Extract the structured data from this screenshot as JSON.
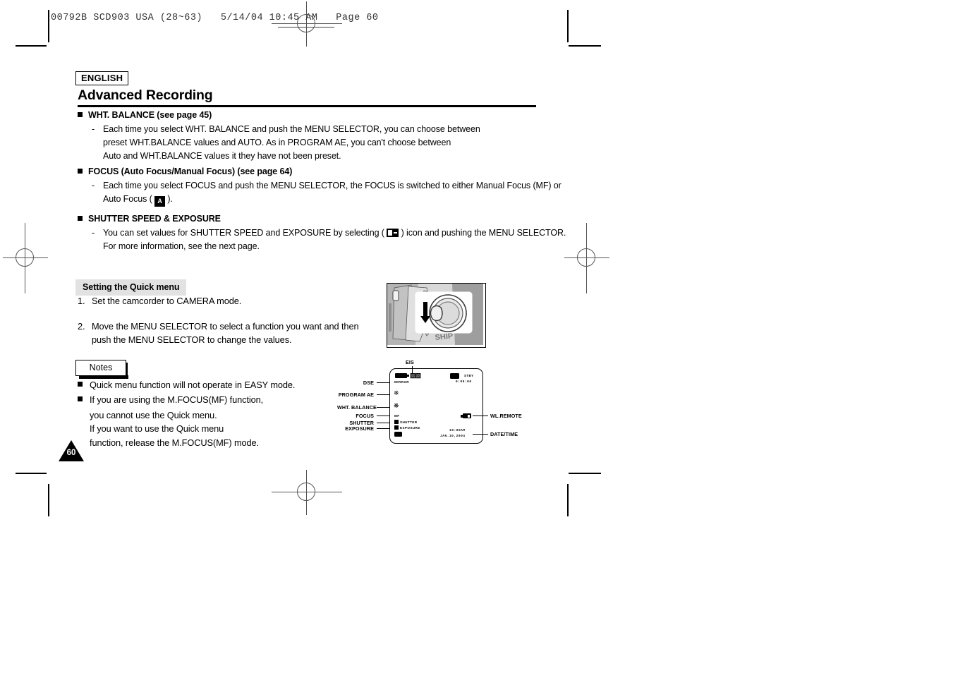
{
  "slug": {
    "text": "00792B SCD903 USA (28~63)   5/14/04 10:45 AM   Page 60"
  },
  "page": {
    "language_badge": "ENGLISH",
    "chapter_title": "Advanced Recording",
    "page_number": "60"
  },
  "sections": [
    {
      "heading": "WHT. BALANCE (see page 45)",
      "lines": [
        "Each time you select WHT. BALANCE and push the MENU SELECTOR, you can choose between",
        "preset WHT.BALANCE values and AUTO. As in PROGRAM AE, you can't choose between",
        "Auto and WHT.BALANCE values it they have not been preset."
      ]
    },
    {
      "heading": "FOCUS (Auto Focus/Manual Focus) (see page 64)",
      "lines": [
        "Each time you select FOCUS and push the MENU SELECTOR, the FOCUS is switched to either Manual Focus (MF) or",
        "Auto Focus (  )."
      ],
      "inline_icon": "auto-focus-a-icon"
    },
    {
      "heading": "SHUTTER SPEED & EXPOSURE",
      "lines": [
        "You can set values for SHUTTER SPEED and EXPOSURE by selecting (  ) icon and pushing the MENU SELECTOR.",
        "For more information, see the next page."
      ],
      "inline_icon": "shutter-exposure-icon"
    }
  ],
  "quick_menu": {
    "title": "Setting the Quick menu",
    "steps": [
      {
        "num": "1.",
        "text": "Set the camcorder to CAMERA mode."
      },
      {
        "num": "2.",
        "text": "Move the MENU SELECTOR to select a function you want and then push the MENU SELECTOR to change the values."
      }
    ]
  },
  "notes": {
    "title": "Notes",
    "items": [
      {
        "main": "Quick menu function will not operate in EASY mode.",
        "continuation": []
      },
      {
        "main": "If you are using the M.FOCUS(MF) function,",
        "continuation": [
          "you cannot use the Quick menu.",
          "If you want to use the Quick menu",
          "function, release the M.FOCUS(MF) mode."
        ]
      }
    ]
  },
  "lcd_diagram": {
    "callouts_left": [
      {
        "label": "DSE"
      },
      {
        "label": "PROGRAM AE"
      },
      {
        "label": "WHT. BALANCE"
      },
      {
        "label": "FOCUS"
      },
      {
        "label": "SHUTTER"
      },
      {
        "label": "EXPOSURE"
      }
    ],
    "callouts_top": [
      {
        "label": "EIS"
      }
    ],
    "callouts_right": [
      {
        "label": "WL.REMOTE"
      },
      {
        "label": "DATE/TIME"
      }
    ],
    "osd": {
      "dse_mode": "MIRROR",
      "focus_mode": "MF",
      "shutter_text": "SHUTTER",
      "exposure_text": "EXPOSURE",
      "record_mode": "STBY",
      "timecode": "0:00:00",
      "time": "10:00AM",
      "date": "JAN.10,2004"
    }
  }
}
